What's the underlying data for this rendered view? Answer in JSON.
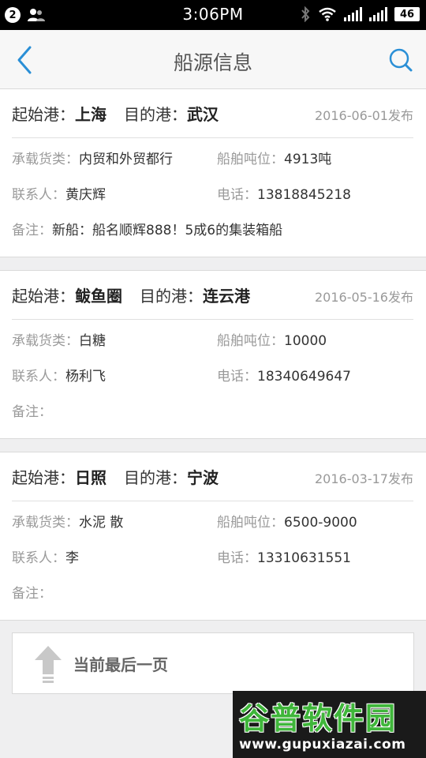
{
  "status_bar": {
    "notification_count": "2",
    "time": "3:06PM",
    "battery": "46"
  },
  "header": {
    "title": "船源信息",
    "back_icon": "chevron-left-icon",
    "search_icon": "search-icon"
  },
  "labels": {
    "origin": "起始港：",
    "destination": "目的港：",
    "cargo": "承载货类：",
    "tonnage": "船舶吨位：",
    "contact": "联系人：",
    "phone": "电话：",
    "remark": "备注："
  },
  "listings": [
    {
      "origin": "上海",
      "destination": "武汉",
      "date": "2016-06-01发布",
      "cargo": "内贸和外贸都行",
      "tonnage": "4913吨",
      "contact": "黄庆辉",
      "phone": "13818845218",
      "remark": "新船：船名顺辉888！5成6的集装箱船"
    },
    {
      "origin": "鲅鱼圈",
      "destination": "连云港",
      "date": "2016-05-16发布",
      "cargo": "白糖",
      "tonnage": "10000",
      "contact": "杨利飞",
      "phone": "18340649647",
      "remark": ""
    },
    {
      "origin": "日照",
      "destination": "宁波",
      "date": "2016-03-17发布",
      "cargo": "水泥 散",
      "tonnage": "6500-9000",
      "contact": "李",
      "phone": "13310631551",
      "remark": ""
    }
  ],
  "footer": {
    "label": "当前最后一页",
    "icon": "arrow-up-icon"
  },
  "watermark": {
    "brand": "谷普软件园",
    "url": "www.gupuxiazai.com"
  },
  "colors": {
    "accent": "#2a8fd6",
    "background": "#efeff0",
    "watermark_green": "#3fb63a"
  }
}
